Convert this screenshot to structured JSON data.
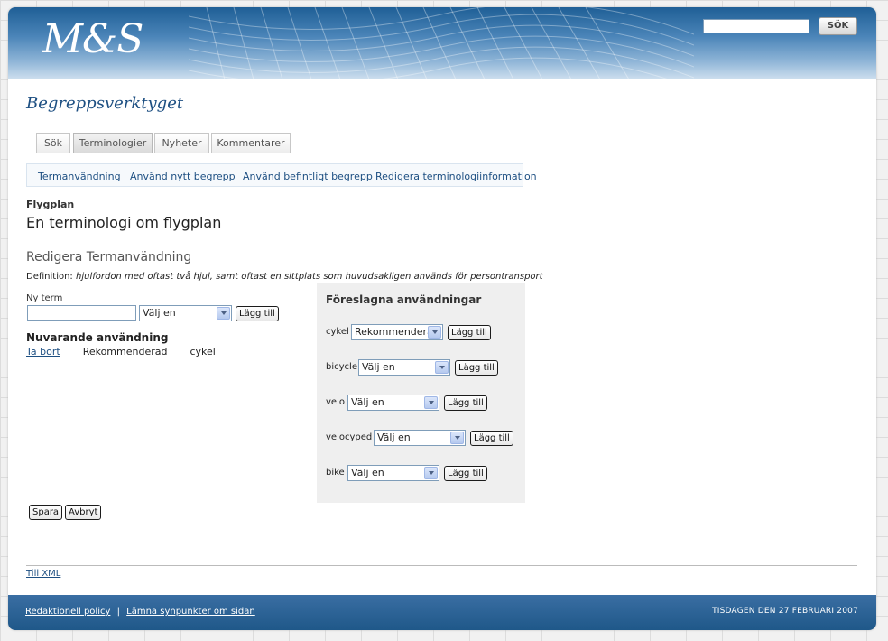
{
  "header": {
    "logo_text": "M&S",
    "search_placeholder": "",
    "search_button_label": "SÖK"
  },
  "app_title": "Begreppsverktyget",
  "tabs": [
    {
      "label": "Sök",
      "active": false
    },
    {
      "label": "Terminologier",
      "active": true
    },
    {
      "label": "Nyheter",
      "active": false
    },
    {
      "label": "Kommentarer",
      "active": false
    }
  ],
  "subtabs": [
    {
      "label": "Termanvändning"
    },
    {
      "label": "Använd nytt begrepp"
    },
    {
      "label": "Använd befintligt begrepp"
    },
    {
      "label": "Redigera terminologiinformation"
    }
  ],
  "terminology": {
    "name": "Flygplan",
    "description": "En terminologi om flygplan"
  },
  "edit": {
    "section_title": "Redigera Termanvändning",
    "definition_label": "Definition:",
    "definition_text": "hjulfordon med oftast två hjul, samt oftast en sittplats som huvudsakligen används för persontransport",
    "new_term_label": "Ny term",
    "new_term_value": "",
    "new_term_select": "Välj en",
    "add_button_label": "Lägg till",
    "current_title": "Nuvarande användning",
    "current_usage": {
      "remove_label": "Ta bort",
      "status": "Rekommenderad",
      "term": "cykel"
    },
    "save_label": "Spara",
    "cancel_label": "Avbryt"
  },
  "suggestions": {
    "title": "Föreslagna användningar",
    "add_button_label": "Lägg till",
    "items": [
      {
        "word": "cykel",
        "select": "Rekommenderad"
      },
      {
        "word": "bicycle",
        "select": "Välj en"
      },
      {
        "word": "velo",
        "select": "Välj en"
      },
      {
        "word": "velocyped",
        "select": "Välj en"
      },
      {
        "word": "bike",
        "select": "Välj en"
      }
    ]
  },
  "xml_link": "Till XML",
  "footer": {
    "links": [
      "Redaktionell policy",
      "Lämna synpunkter om sidan"
    ],
    "separator": "|",
    "date": "TISDAGEN DEN 27 FEBRUARI 2007"
  },
  "colors": {
    "brand_blue": "#1d4f82",
    "header_top": "#1f5f96",
    "footer": "#2a6296",
    "panel_grey": "#efefef"
  }
}
